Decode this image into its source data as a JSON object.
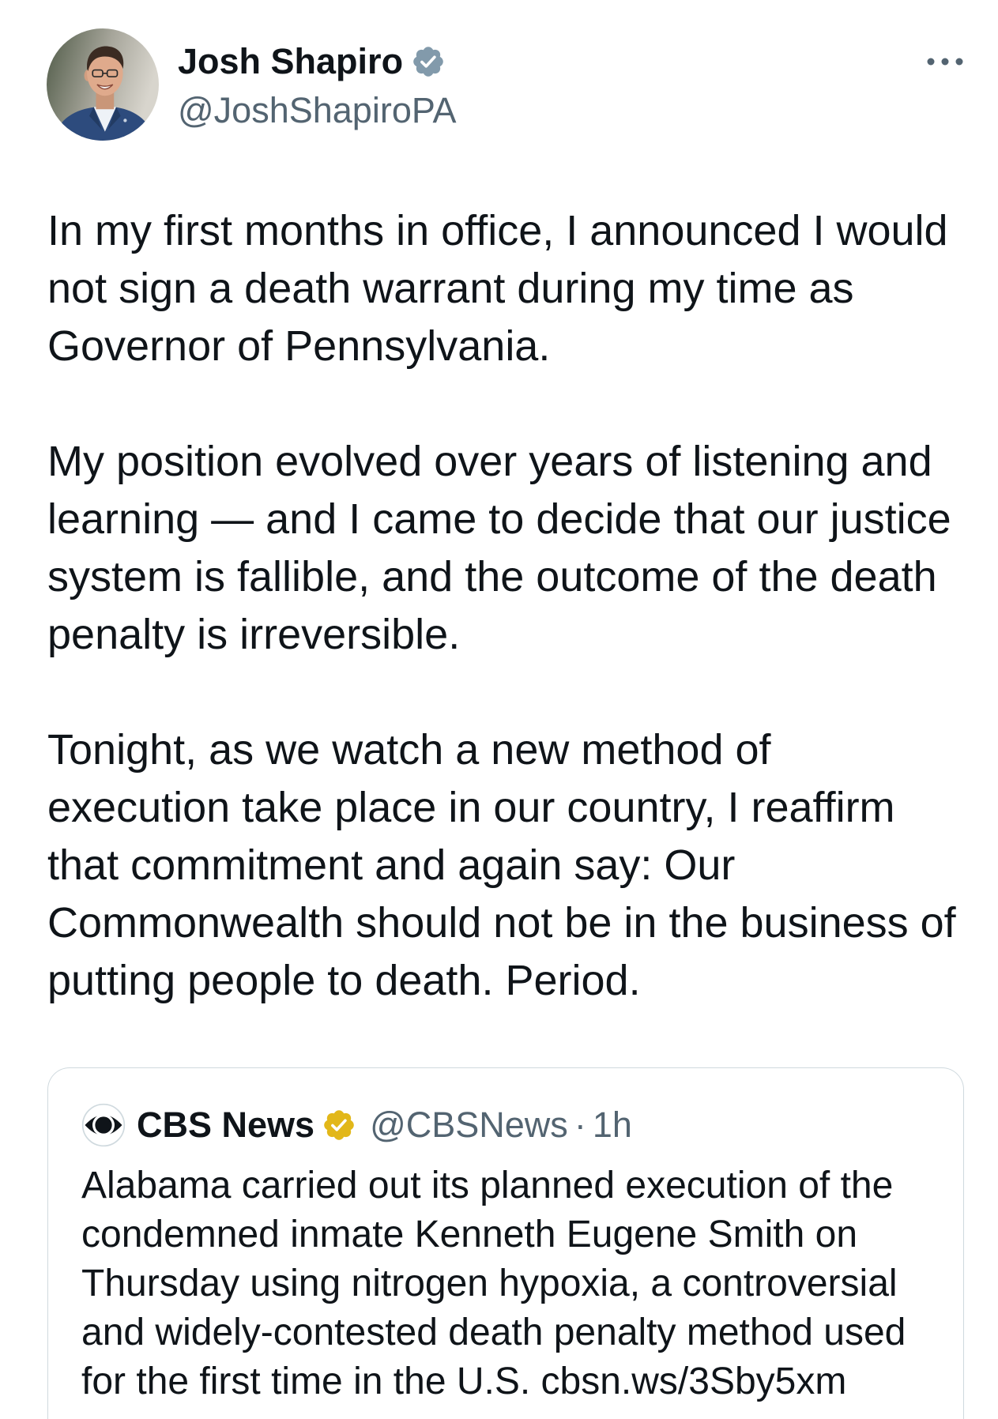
{
  "colors": {
    "text": "#0f1419",
    "secondary": "#536471",
    "border": "#cfd9de",
    "author_badge": "#829aab",
    "quoted_badge": "#e2b719"
  },
  "icons": {
    "author_badge": "verified-badge-icon",
    "more": "more-horizontal-icon",
    "quoted_avatar": "cbs-eye-logo-icon",
    "quoted_badge": "verified-gold-badge-icon"
  },
  "tweet": {
    "author": {
      "name": "Josh Shapiro",
      "handle": "@JoshShapiroPA"
    },
    "body": [
      [
        "In my first months in office, I announced I would",
        "not sign a death warrant during my time as",
        "Governor of Pennsylvania."
      ],
      [
        "My position evolved over years of listening and",
        "learning — and I came to decide that our justice",
        "system is fallible, and the outcome of the death",
        "penalty is irreversible."
      ],
      [
        "Tonight, as we watch a new method of",
        "execution take place in our country, I reaffirm",
        "that commitment and again say: Our",
        "Commonwealth should not be in the business of",
        "putting people to death. Period."
      ]
    ],
    "quoted": {
      "name": "CBS News",
      "handle": "@CBSNews",
      "separator": "·",
      "time": "1h",
      "lines": [
        "Alabama carried out its planned execution of the",
        "condemned inmate Kenneth Eugene Smith on",
        "Thursday using nitrogen hypoxia, a controversial",
        "and widely-contested death penalty method used",
        "for the first time in the U.S. cbsn.ws/3Sby5xm"
      ]
    }
  }
}
